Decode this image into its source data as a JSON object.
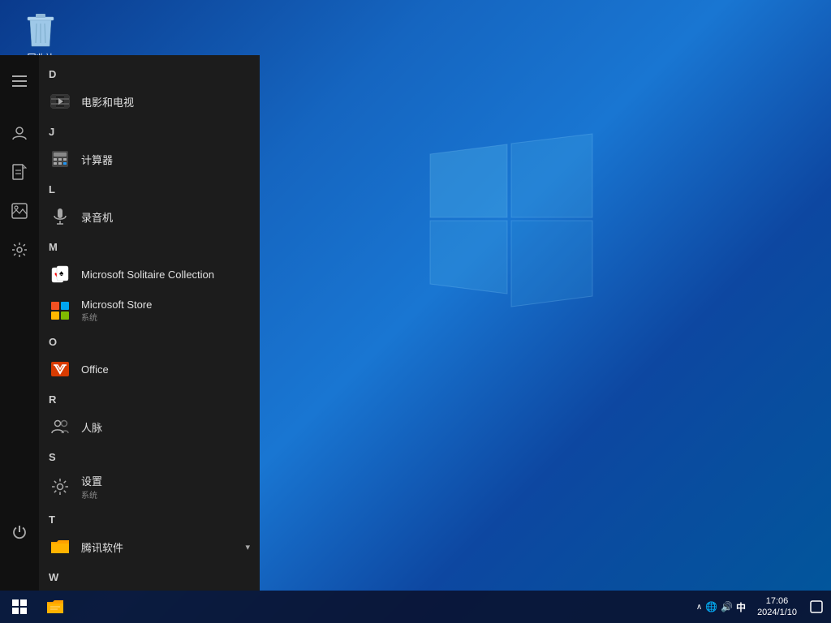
{
  "desktop": {
    "background_description": "Windows 10 default wallpaper - blue gradient with light rays"
  },
  "recycle_bin": {
    "label": "回收站"
  },
  "start_menu": {
    "section_d": "D",
    "section_j": "J",
    "section_l": "L",
    "section_m": "M",
    "section_o": "O",
    "section_r": "R",
    "section_s": "S",
    "section_t": "T",
    "section_w": "W",
    "apps": [
      {
        "id": "movies",
        "name": "电影和电视",
        "icon": "🎬",
        "sub": ""
      },
      {
        "id": "calculator",
        "name": "计算器",
        "icon": "🖩",
        "sub": ""
      },
      {
        "id": "recorder",
        "name": "录音机",
        "icon": "🎤",
        "sub": ""
      },
      {
        "id": "solitaire",
        "name": "Microsoft Solitaire Collection",
        "icon": "🃏",
        "sub": ""
      },
      {
        "id": "store",
        "name": "Microsoft Store",
        "icon": "🏪",
        "sub": "系统"
      },
      {
        "id": "office",
        "name": "Office",
        "icon": "📄",
        "sub": ""
      },
      {
        "id": "contacts",
        "name": "人脉",
        "icon": "👥",
        "sub": ""
      },
      {
        "id": "settings",
        "name": "设置",
        "icon": "⚙",
        "sub": "系统"
      },
      {
        "id": "tencent",
        "name": "腾讯软件",
        "icon": "📁",
        "sub": ""
      }
    ]
  },
  "sidebar": {
    "icons": [
      {
        "id": "hamburger",
        "icon": "☰",
        "label": "menu"
      },
      {
        "id": "user",
        "icon": "👤",
        "label": "user"
      },
      {
        "id": "document",
        "icon": "📄",
        "label": "documents"
      },
      {
        "id": "photos",
        "icon": "🖼",
        "label": "photos"
      },
      {
        "id": "settings",
        "icon": "⚙",
        "label": "settings"
      },
      {
        "id": "power",
        "icon": "⏻",
        "label": "power"
      }
    ]
  },
  "taskbar": {
    "start_label": "",
    "tray": {
      "chevron": "∧",
      "lang": "中",
      "speaker": "🔊",
      "network": "🌐",
      "notification": "💬"
    },
    "clock": {
      "time": "17:06",
      "date": "2024/1/10"
    },
    "file_explorer_label": "文件资源管理器"
  }
}
